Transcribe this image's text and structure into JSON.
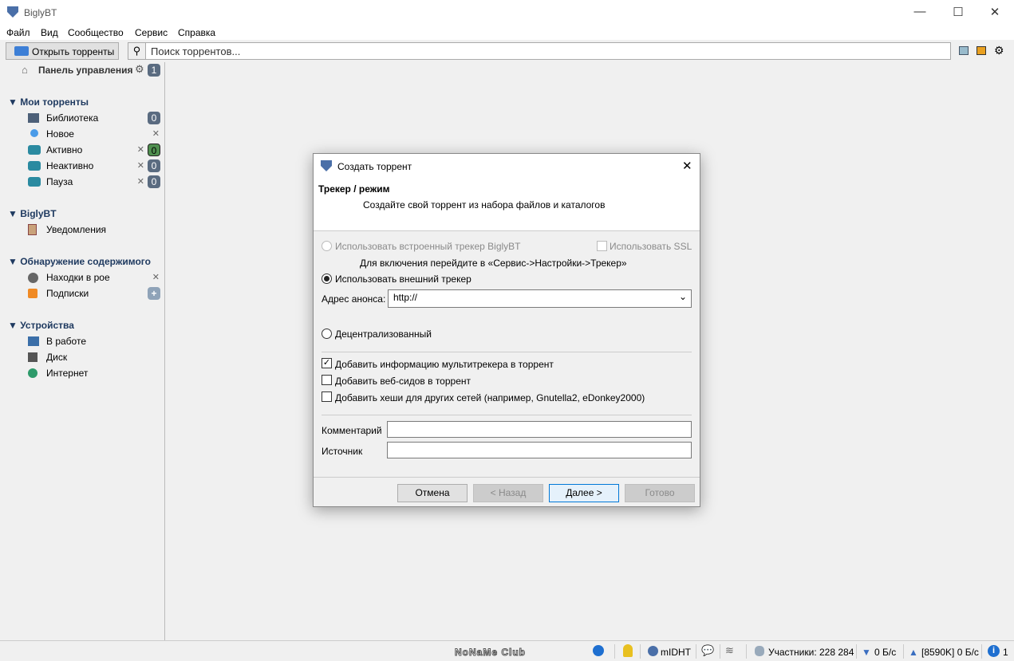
{
  "app": {
    "title": "BiglyBT",
    "minimize": "—",
    "maximize": "☐",
    "close": "✕"
  },
  "menu": [
    "Файл",
    "Вид",
    "Сообщество",
    "Сервис",
    "Справка"
  ],
  "toolbar": {
    "open_label": "Открыть торренты",
    "search_placeholder": "Поиск торрентов...",
    "icons": [
      "tiles-icon",
      "chart-icon",
      "gear-icon"
    ]
  },
  "sidebar": {
    "dashboard": {
      "label": "Панель управления",
      "badge": "1"
    },
    "sections": [
      {
        "title": "▼ Мои торренты",
        "items": [
          {
            "label": "Библиотека",
            "badge": "0"
          },
          {
            "label": "Новое",
            "close": "✕"
          },
          {
            "label": "Активно",
            "close": "✕",
            "badge": "0"
          },
          {
            "label": "Неактивно",
            "close": "✕",
            "badge": "0"
          },
          {
            "label": "Пауза",
            "close": "✕",
            "badge": "0"
          }
        ]
      },
      {
        "title": "▼ BiglyBT",
        "items": [
          {
            "label": "Уведомления"
          }
        ]
      },
      {
        "title": "▼ Обнаружение содержимого",
        "items": [
          {
            "label": "Находки в рое",
            "close": "✕"
          },
          {
            "label": "Подписки",
            "add": "+"
          }
        ]
      },
      {
        "title": "▼ Устройства",
        "items": [
          {
            "label": "В работе"
          },
          {
            "label": "Диск"
          },
          {
            "label": "Интернет"
          }
        ]
      }
    ]
  },
  "dialog": {
    "title": "Создать торрент",
    "close": "✕",
    "heading": "Трекер / режим",
    "subheading": "Создайте свой торрент из набора файлов и каталогов",
    "builtin_tracker": "Использовать встроенный трекер BiglyBT",
    "use_ssl": "Использовать SSL",
    "builtin_hint": "Для включения перейдите в «Сервис->Настройки->Трекер»",
    "external_tracker": "Использовать внешний трекер",
    "announce_label": "Адрес анонса:",
    "announce_value": "http://",
    "decentralized": "Децентрализованный",
    "multitracker": "Добавить информацию мультитрекера в торрент",
    "multitracker_checked": true,
    "webseeds": "Добавить веб-сидов в торрент",
    "hashes": "Добавить хеши для других сетей (например, Gnutella2, eDonkey2000)",
    "comment_label": "Комментарий",
    "source_label": "Источник",
    "comment_value": "",
    "source_value": "",
    "buttons": {
      "cancel": "Отмена",
      "back": "< Назад",
      "next": "Далее >",
      "finish": "Готово"
    }
  },
  "statusbar": {
    "watermark": "NoNaMe Club",
    "dht": "mIDHT",
    "peers": "Участники: 228 284",
    "down": "0 Б/с",
    "up": "[8590K] 0 Б/с",
    "info_count": "1",
    "down_arrow": "▼",
    "up_arrow": "▲"
  }
}
